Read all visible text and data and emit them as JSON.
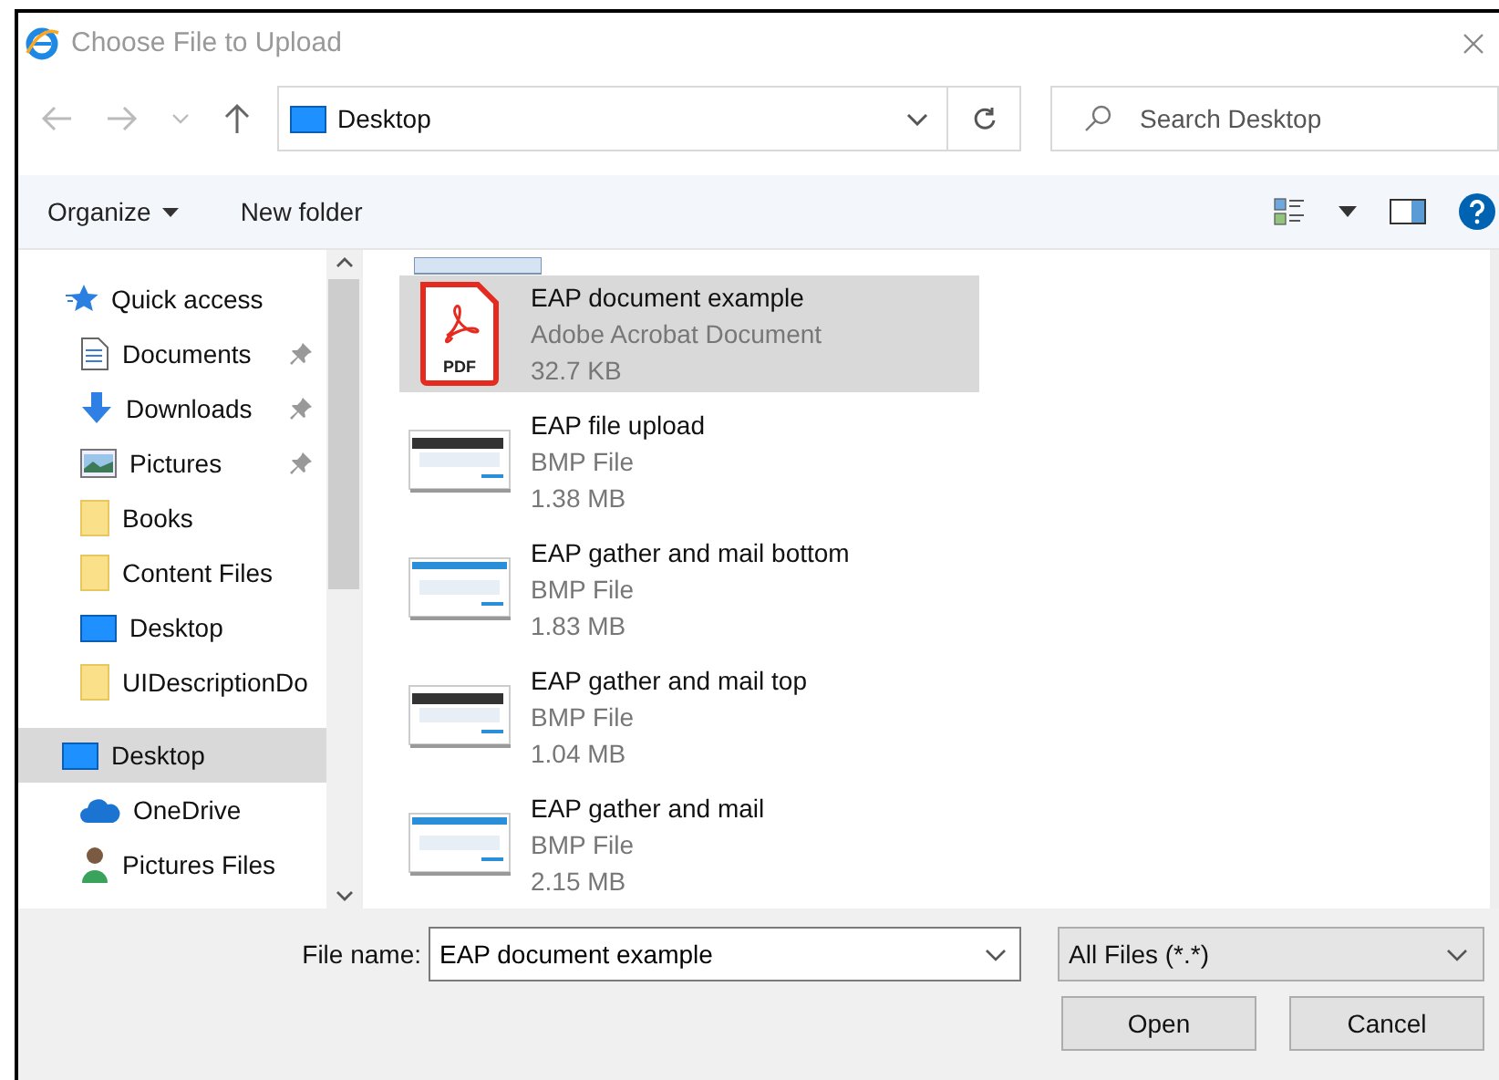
{
  "window": {
    "title": "Choose File to Upload"
  },
  "address": {
    "location": "Desktop",
    "search_placeholder": "Search Desktop"
  },
  "toolbar": {
    "buttons": [
      "Organize",
      "New folder"
    ]
  },
  "sidebar": {
    "items": [
      {
        "label": "Quick access",
        "kind": "star",
        "selected": false,
        "children": [
          {
            "label": "Documents",
            "kind": "document",
            "pinned": true,
            "selected": false
          },
          {
            "label": "Downloads",
            "kind": "download",
            "pinned": true,
            "selected": false
          },
          {
            "label": "Pictures",
            "kind": "pictures",
            "pinned": true,
            "selected": false
          },
          {
            "label": "Books",
            "kind": "folder",
            "pinned": false,
            "selected": false
          },
          {
            "label": "Content Files",
            "kind": "folder",
            "pinned": false,
            "selected": false
          },
          {
            "label": "Desktop",
            "kind": "desktop",
            "pinned": false,
            "selected": false
          },
          {
            "label": "UIDescriptionDo",
            "kind": "folder",
            "pinned": false,
            "selected": false
          }
        ]
      },
      {
        "label": "Desktop",
        "kind": "desktop",
        "selected": true,
        "children": [
          {
            "label": "OneDrive",
            "kind": "cloud",
            "pinned": false,
            "selected": false
          },
          {
            "label": "Pictures Files",
            "kind": "user",
            "pinned": false,
            "selected": false
          }
        ]
      }
    ]
  },
  "files": [
    {
      "name": "EAP document example",
      "type": "Adobe Acrobat Document",
      "size": "32.7 KB",
      "kind": "pdf",
      "badge": "PDF",
      "selected": true
    },
    {
      "name": "EAP file upload",
      "type": "BMP File",
      "size": "1.38 MB",
      "kind": "bmp",
      "selected": false
    },
    {
      "name": "EAP gather and mail bottom",
      "type": "BMP File",
      "size": "1.83 MB",
      "kind": "bmp",
      "selected": false
    },
    {
      "name": "EAP gather and mail top",
      "type": "BMP File",
      "size": "1.04 MB",
      "kind": "bmp",
      "selected": false
    },
    {
      "name": "EAP gather and mail",
      "type": "BMP File",
      "size": "2.15 MB",
      "kind": "bmp",
      "selected": false
    }
  ],
  "footer": {
    "file_name_label": "File name:",
    "file_name": "EAP document example",
    "filter": "All Files (*.*)",
    "buttons": [
      "Open",
      "Cancel"
    ]
  }
}
